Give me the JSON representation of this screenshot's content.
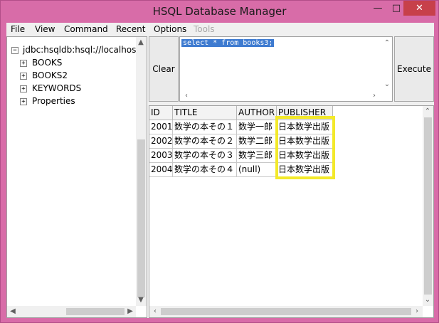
{
  "window": {
    "title": "HSQL Database Manager",
    "minimize_glyph": "—",
    "maximize_glyph": "□",
    "close_glyph": "✕"
  },
  "menu": [
    "File",
    "View",
    "Command",
    "Recent",
    "Options",
    "Tools"
  ],
  "menu_disabled": [
    "Tools"
  ],
  "tree": {
    "root": "jdbc:hsqldb:hsql://localhost/",
    "root_expander": "−",
    "items": [
      {
        "label": "BOOKS",
        "expander": "+"
      },
      {
        "label": "BOOKS2",
        "expander": "+"
      },
      {
        "label": "KEYWORDS",
        "expander": "+"
      },
      {
        "label": "Properties",
        "expander": "+"
      }
    ]
  },
  "buttons": {
    "clear": "Clear",
    "execute": "Execute"
  },
  "sql": {
    "text": "select * from books3;"
  },
  "table": {
    "columns": [
      "ID",
      "TITLE",
      "AUTHOR",
      "PUBLISHER"
    ],
    "rows": [
      [
        "2001",
        "数学の本その１",
        "数学一郎",
        "日本数学出版"
      ],
      [
        "2002",
        "数学の本その２",
        "数学二郎",
        "日本数学出版"
      ],
      [
        "2003",
        "数学の本その３",
        "数学三郎",
        "日本数学出版"
      ],
      [
        "2004",
        "数学の本その４",
        "(null)",
        "日本数学出版"
      ]
    ]
  },
  "colors": {
    "highlight": "#f3e92a",
    "selection": "#3e7bd0",
    "window_border": "#d86ca8",
    "close_button": "#c7404a"
  },
  "icons": {
    "up": "up-arrow-icon",
    "down": "down-arrow-icon",
    "left": "left-arrow-icon",
    "right": "right-arrow-icon"
  }
}
